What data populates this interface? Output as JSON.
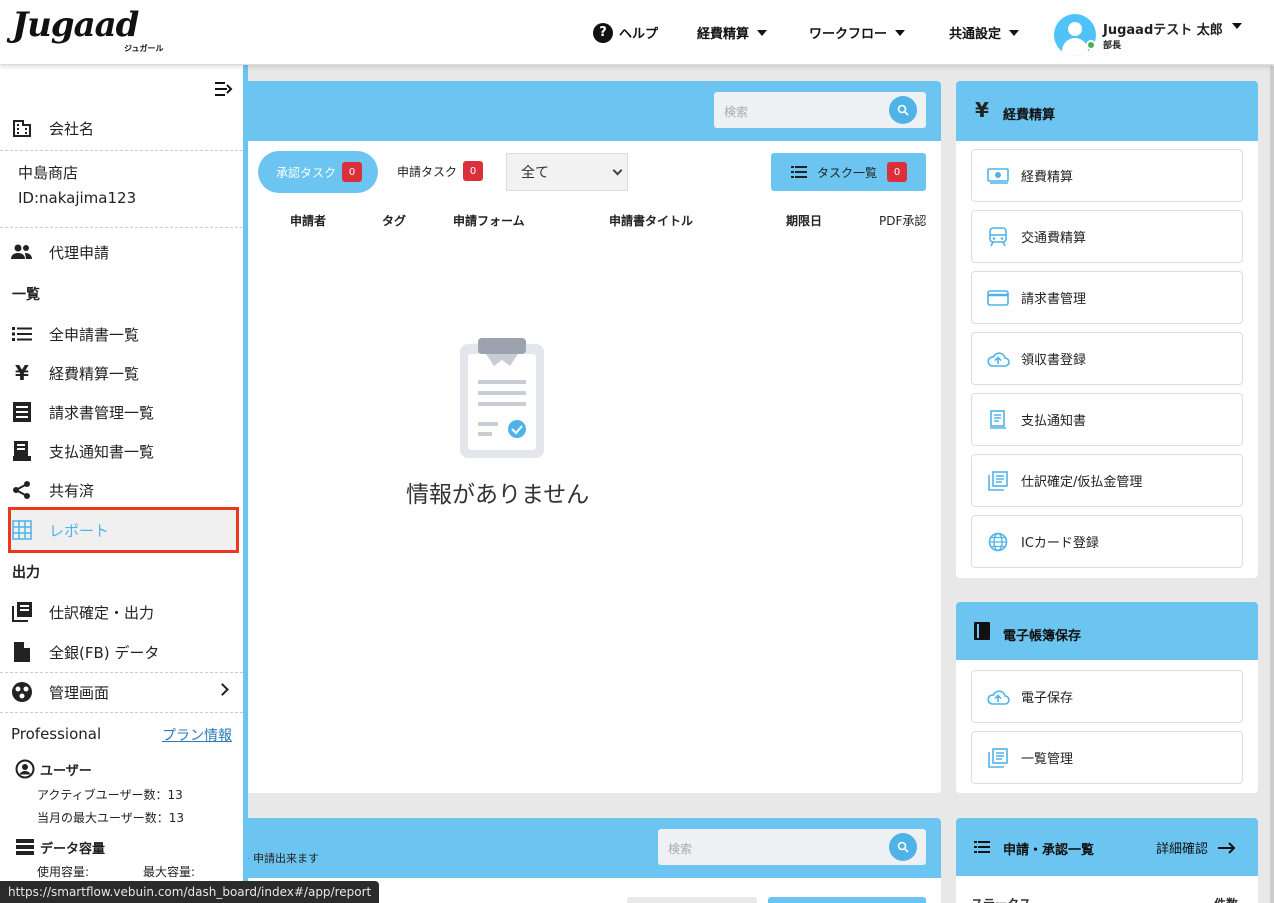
{
  "header": {
    "logo": "Jugaad",
    "logo_sub": "ジュガール",
    "nav": [
      {
        "label": "ヘルプ"
      },
      {
        "label": "経費精算"
      },
      {
        "label": "ワークフロー"
      },
      {
        "label": "共通設定"
      }
    ],
    "user": {
      "name": "Jugaadテスト 太郎",
      "role": "部長"
    }
  },
  "sidebar": {
    "company_label": "会社名",
    "company_name": "中島商店",
    "company_id": "ID:nakajima123",
    "proxy": "代理申請",
    "section_list": "一覧",
    "items": [
      {
        "label": "全申請書一覧"
      },
      {
        "label": "経費精算一覧"
      },
      {
        "label": "請求書管理一覧"
      },
      {
        "label": "支払通知書一覧"
      },
      {
        "label": "共有済"
      },
      {
        "label": "レポート"
      }
    ],
    "section_output": "出力",
    "output_items": [
      {
        "label": "仕訳確定・出力"
      },
      {
        "label": "全銀(FB) データ"
      }
    ],
    "admin": "管理画面",
    "plan": "Professional",
    "plan_link": "プラン情報",
    "users_head": "ユーザー",
    "active_users": "アクティブユーザー数：13",
    "max_users": "当月の最大ユーザー数：13",
    "storage_head": "データ容量",
    "used": "使用容量:",
    "max": "最大容量:"
  },
  "tasks": {
    "search_placeholder": "検索",
    "approval_tab": "承認タスク",
    "approval_count": "0",
    "request_tab": "申請タスク",
    "request_count": "0",
    "filter_value": "全て",
    "task_list_btn": "タスク一覧",
    "task_list_count": "0",
    "columns": [
      "申請者",
      "タグ",
      "申請フォーム",
      "申請書タイトル",
      "期限日",
      "PDF承認"
    ],
    "empty": "情報がありません"
  },
  "bottom_card": {
    "search_placeholder": "検索",
    "note": "申請出来ます"
  },
  "expense_card": {
    "title": "経費精算",
    "items": [
      {
        "label": "経費精算"
      },
      {
        "label": "交通費精算"
      },
      {
        "label": "請求書管理"
      },
      {
        "label": "領収書登録"
      },
      {
        "label": "支払通知書"
      },
      {
        "label": "仕訳確定/仮払金管理"
      },
      {
        "label": "ICカード登録"
      }
    ]
  },
  "ebook_card": {
    "title": "電子帳簿保存",
    "items": [
      {
        "label": "電子保存"
      },
      {
        "label": "一覧管理"
      }
    ]
  },
  "approval_card": {
    "title": "申請・承認一覧",
    "detail": "詳細確認",
    "status": "ステータス",
    "count": "件数"
  },
  "status_url": "https://smartflow.vebuin.com/dash_board/index#/app/report",
  "colors": {
    "accent": "#6cc5f0",
    "badge": "#dc2f3c",
    "highlight": "#e8391d"
  }
}
